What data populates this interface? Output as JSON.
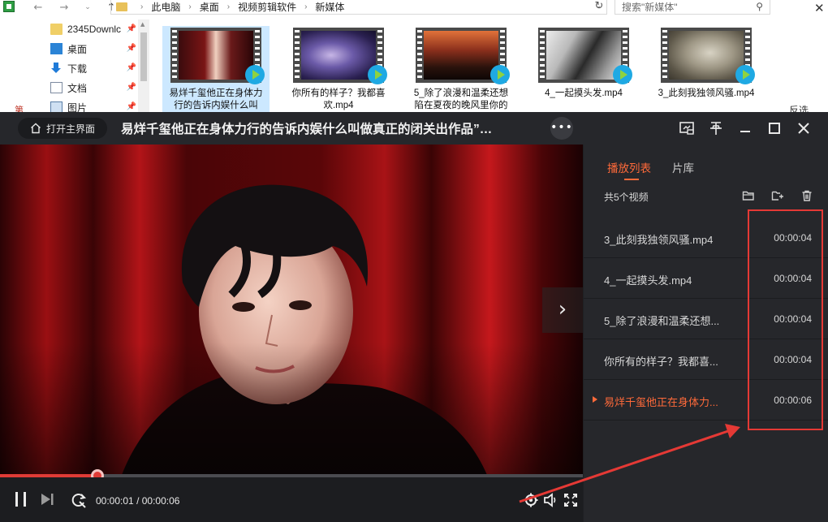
{
  "explorer": {
    "breadcrumb": [
      "此电脑",
      "桌面",
      "视频剪辑软件",
      "新媒体"
    ],
    "search_placeholder": "搜索\"新媒体\"",
    "sidebar_items": [
      {
        "label": "2345Downlc",
        "icon": "folder-icon",
        "pinned": true
      },
      {
        "label": "桌面",
        "icon": "desktop-icon",
        "pinned": true
      },
      {
        "label": "下载",
        "icon": "download-icon",
        "pinned": true
      },
      {
        "label": "文档",
        "icon": "document-icon",
        "pinned": true
      },
      {
        "label": "图片",
        "icon": "picture-icon",
        "pinned": true
      }
    ],
    "files": [
      {
        "name": "易烊千玺他正在身体力行的告诉内娱什么叫",
        "selected": true
      },
      {
        "name": "你所有的样子？我都喜欢.mp4",
        "selected": false
      },
      {
        "name": "5_除了浪漫和温柔还想陷在夏夜的晚风里你的",
        "selected": false
      },
      {
        "name": "4_一起摸头发.mp4",
        "selected": false
      },
      {
        "name": "3_此刻我独领风骚.mp4",
        "selected": false
      }
    ],
    "left_bg_text": "第",
    "right_bg_text": "反选"
  },
  "player": {
    "home_label": "打开主界面",
    "title": "易烊千玺他正在身体力行的告诉内娱什么叫做真正的闭关出作品”…",
    "more_label": "•••",
    "current_time": "00:00:01",
    "total_time": "00:00:06",
    "progress": 0.1667,
    "sidebar": {
      "tabs": [
        {
          "label": "播放列表",
          "active": true
        },
        {
          "label": "片库",
          "active": false
        }
      ],
      "count_label": "共5个视频",
      "playlist": [
        {
          "name": "3_此刻我独领风骚.mp4",
          "duration": "00:00:04",
          "current": false
        },
        {
          "name": "4_一起摸头发.mp4",
          "duration": "00:00:04",
          "current": false
        },
        {
          "name": "5_除了浪漫和温柔还想...",
          "duration": "00:00:04",
          "current": false
        },
        {
          "name": "你所有的样子？我都喜...",
          "duration": "00:00:04",
          "current": false
        },
        {
          "name": "易烊千玺他正在身体力...",
          "duration": "00:00:06",
          "current": true
        }
      ]
    }
  },
  "colors": {
    "accent": "#ff6a3a",
    "progress": "#e03b36",
    "annotation": "#e53935"
  }
}
